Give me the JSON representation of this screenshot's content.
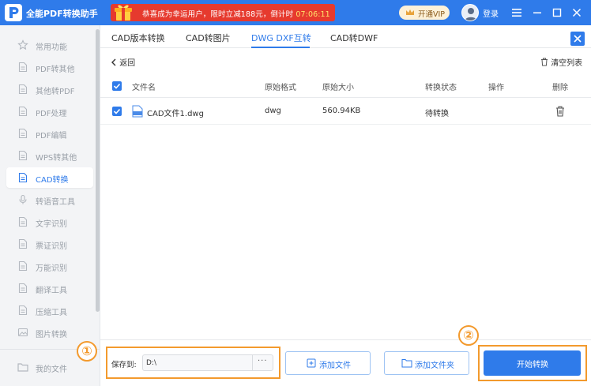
{
  "app": {
    "title": "全能PDF转换助手",
    "promo_text": "恭喜成为幸运用户，限时立减188元，倒计时 ",
    "promo_timer": "07:06:11",
    "vip_label": "开通VIP",
    "login_label": "登录"
  },
  "sidebar": {
    "items": [
      {
        "label": "常用功能",
        "icon": "star-icon"
      },
      {
        "label": "PDF转其他",
        "icon": "pdf-convert-icon"
      },
      {
        "label": "其他转PDF",
        "icon": "to-pdf-icon"
      },
      {
        "label": "PDF处理",
        "icon": "pdf-process-icon"
      },
      {
        "label": "PDF编辑",
        "icon": "pdf-edit-icon"
      },
      {
        "label": "WPS转其他",
        "icon": "wps-icon"
      },
      {
        "label": "CAD转换",
        "icon": "cad-icon"
      },
      {
        "label": "转语音工具",
        "icon": "voice-icon"
      },
      {
        "label": "文字识别",
        "icon": "ocr-icon"
      },
      {
        "label": "票证识别",
        "icon": "ticket-icon"
      },
      {
        "label": "万能识别",
        "icon": "universal-ocr-icon"
      },
      {
        "label": "翻译工具",
        "icon": "translate-icon"
      },
      {
        "label": "压缩工具",
        "icon": "compress-icon"
      },
      {
        "label": "图片转换",
        "icon": "image-icon"
      }
    ],
    "active_index": 6,
    "my_files_label": "我的文件"
  },
  "tabs": [
    {
      "label": "CAD版本转换"
    },
    {
      "label": "CAD转图片"
    },
    {
      "label": "DWG DXF互转"
    },
    {
      "label": "CAD转DWF"
    }
  ],
  "active_tab": 2,
  "toolbar": {
    "back_label": "返回",
    "clear_label": "清空列表"
  },
  "table": {
    "headers": {
      "filename": "文件名",
      "format": "原始格式",
      "size": "原始大小",
      "status": "转换状态",
      "action": "操作",
      "delete": "删除"
    },
    "rows": [
      {
        "filename": "CAD文件1.dwg",
        "format": "dwg",
        "size": "560.94KB",
        "status": "待转换",
        "checked": true
      }
    ]
  },
  "bottom": {
    "save_label": "保存到:",
    "save_path": "D:\\",
    "browse_label": "···",
    "add_file_label": "添加文件",
    "add_folder_label": "添加文件夹",
    "start_label": "开始转换"
  },
  "annotations": {
    "step1": "①",
    "step2": "②"
  },
  "colors": {
    "accent": "#2f7bea",
    "promo": "#e63a2e",
    "annotation": "#f39a2d"
  }
}
